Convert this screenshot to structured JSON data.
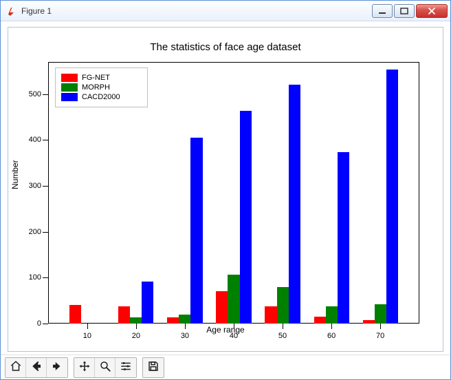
{
  "window": {
    "title": "Figure 1"
  },
  "toolbar": {
    "home": "home-icon",
    "back": "arrow-left-icon",
    "forward": "arrow-right-icon",
    "pan": "move-icon",
    "zoom": "magnify-icon",
    "config": "sliders-icon",
    "save": "save-icon"
  },
  "chart_data": {
    "type": "bar",
    "title": "The statistics of face age dataset",
    "xlabel": "Age range",
    "ylabel": "Number",
    "categories": [
      10,
      20,
      30,
      40,
      50,
      60,
      70
    ],
    "yticks": [
      0,
      100,
      200,
      300,
      400,
      500
    ],
    "ylim": [
      0,
      570
    ],
    "series": [
      {
        "name": "FG-NET",
        "color": "#ff0000",
        "values": [
          40,
          38,
          13,
          70,
          38,
          15,
          8
        ]
      },
      {
        "name": "MORPH",
        "color": "#008000",
        "values": [
          0,
          13,
          20,
          107,
          80,
          37,
          42
        ]
      },
      {
        "name": "CACD2000",
        "color": "#0000ff",
        "values": [
          0,
          92,
          405,
          464,
          520,
          373,
          553
        ]
      }
    ],
    "legend_position": "upper left"
  }
}
